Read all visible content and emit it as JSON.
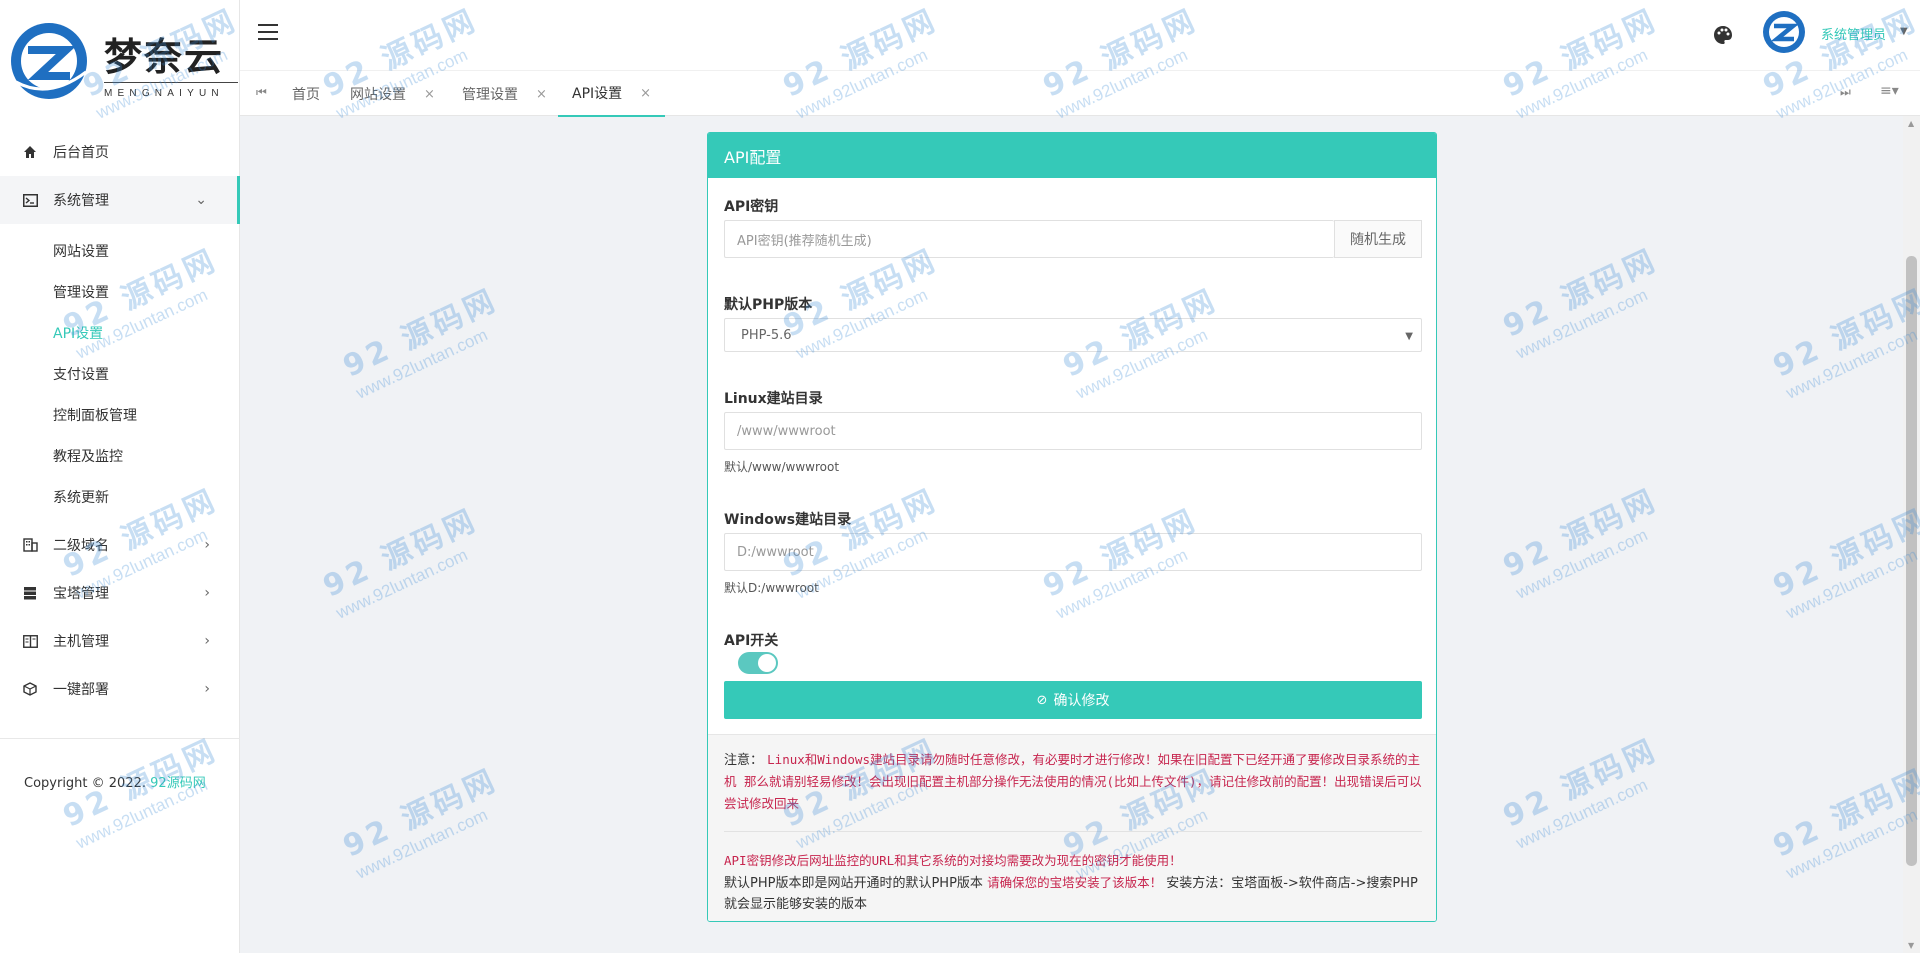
{
  "brand": {
    "name_cn": "梦奈云",
    "name_en": "MENGNAIYUN"
  },
  "header": {
    "user_name": "系统管理员"
  },
  "tabs": [
    {
      "label": "首页",
      "closable": false
    },
    {
      "label": "网站设置",
      "closable": true
    },
    {
      "label": "管理设置",
      "closable": true
    },
    {
      "label": "API设置",
      "closable": true,
      "active": true
    }
  ],
  "sidebar": {
    "items": [
      {
        "label": "后台首页",
        "icon": "home-icon"
      },
      {
        "label": "系统管理",
        "icon": "terminal-icon",
        "expanded": true
      },
      {
        "label": "二级域名",
        "icon": "building-icon"
      },
      {
        "label": "宝塔管理",
        "icon": "server-icon"
      },
      {
        "label": "主机管理",
        "icon": "columns-icon"
      },
      {
        "label": "一键部署",
        "icon": "cube-icon"
      }
    ],
    "submenu": [
      {
        "label": "网站设置"
      },
      {
        "label": "管理设置"
      },
      {
        "label": "API设置",
        "active": true
      },
      {
        "label": "支付设置"
      },
      {
        "label": "控制面板管理"
      },
      {
        "label": "教程及监控"
      },
      {
        "label": "系统更新"
      }
    ],
    "copyright_prefix": "Copyright © 2022.",
    "copyright_brand": "92源码网"
  },
  "card": {
    "title": "API配置",
    "api_key": {
      "label": "API密钥",
      "placeholder": "API密钥(推荐随机生成)",
      "addon": "随机生成"
    },
    "php_version": {
      "label": "默认PHP版本",
      "value": "PHP-5.6"
    },
    "linux_dir": {
      "label": "Linux建站目录",
      "placeholder": "/www/wwwroot",
      "help": "默认/www/wwwroot"
    },
    "windows_dir": {
      "label": "Windows建站目录",
      "placeholder": "D:/wwwroot",
      "help": "默认D:/wwwroot"
    },
    "api_switch": {
      "label": "API开关",
      "on": true
    },
    "confirm_label": "确认修改"
  },
  "notes": {
    "prefix": "注意：",
    "warning": "Linux和Windows建站目录请勿随时任意修改，有必要时才进行修改！如果在旧配置下已经开通了要修改目录系统的主机 那么就请别轻易修改！会出现旧配置主机部分操作无法使用的情况(比如上传文件)，请记住修改前的配置！出现错误后可以尝试修改回来",
    "api_note": "API密钥修改后网址监控的URL和其它系统的对接均需要改为现在的密钥才能使用！",
    "php_note_start": "默认PHP版本即是网站开通时的默认PHP版本",
    "php_note_red": "请确保您的宝塔安装了该版本！",
    "php_note_end": "安装方法：宝塔面板->软件商店->搜索PHP就会显示能够安装的版本"
  },
  "watermark": {
    "big": "92 源码网",
    "small": "www.92luntan.com"
  },
  "colors": {
    "accent": "#35c9b8",
    "danger": "#c7254e"
  }
}
